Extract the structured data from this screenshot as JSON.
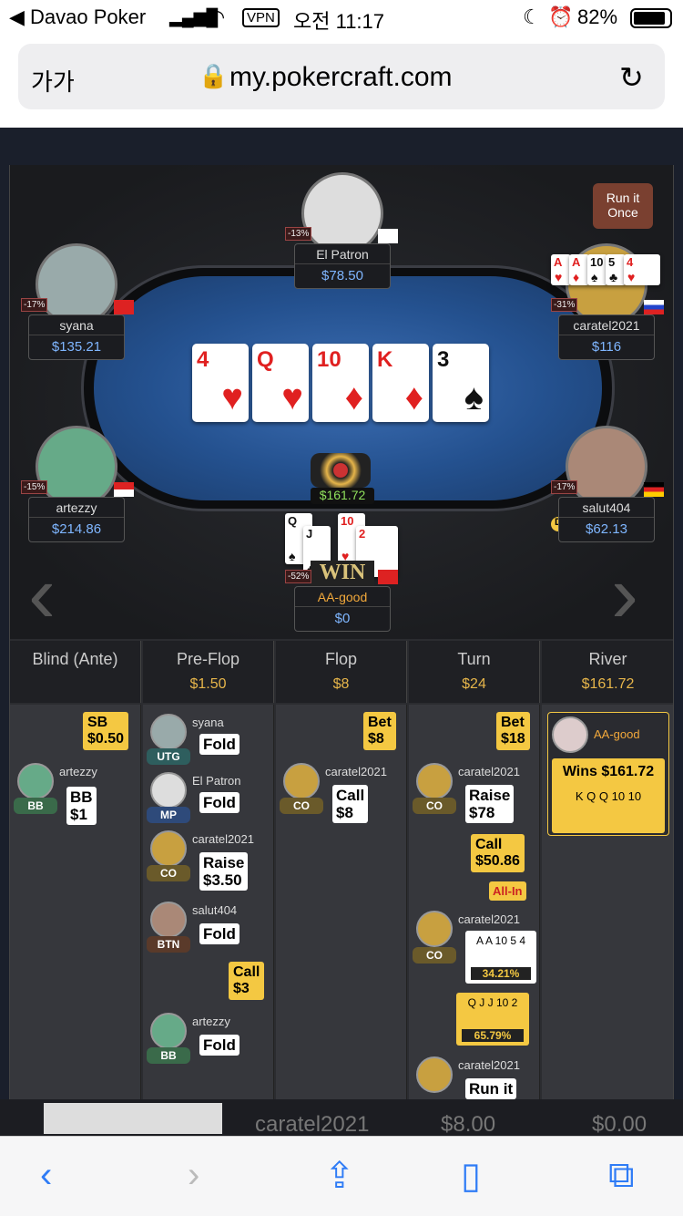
{
  "status_bar": {
    "carrier": "◀ Davao Poker",
    "vpn": "VPN",
    "time": "오전 11:17",
    "battery": "82%"
  },
  "browser": {
    "text_size": "가가",
    "url": "my.pokercraft.com"
  },
  "table": {
    "run_it_once": "Run it\nOnce",
    "pot": "$161.72",
    "win": "WIN",
    "board": [
      {
        "rank": "4",
        "suit": "♥",
        "color": "red"
      },
      {
        "rank": "Q",
        "suit": "♥",
        "color": "red"
      },
      {
        "rank": "10",
        "suit": "♦",
        "color": "red"
      },
      {
        "rank": "K",
        "suit": "♦",
        "color": "red"
      },
      {
        "rank": "3",
        "suit": "♠",
        "color": "blk"
      }
    ],
    "players": [
      {
        "name": "El Patron",
        "stack": "$78.50",
        "pct": "-13%"
      },
      {
        "name": "syana",
        "stack": "$135.21",
        "pct": "-17%"
      },
      {
        "name": "caratel2021",
        "stack": "$116",
        "pct": "-31%"
      },
      {
        "name": "artezzy",
        "stack": "$214.86",
        "pct": "-15%"
      },
      {
        "name": "salut404",
        "stack": "$62.13",
        "pct": "-17%"
      },
      {
        "name": "AA-good",
        "stack": "$0",
        "pct": "-52%"
      }
    ],
    "caratel_cards": [
      "A",
      "A",
      "10",
      "5",
      "4"
    ],
    "hero_cards": [
      "Q",
      "J",
      "10",
      "2"
    ]
  },
  "streets": [
    {
      "name": "Blind (Ante)",
      "pot": ""
    },
    {
      "name": "Pre-Flop",
      "pot": "$1.50"
    },
    {
      "name": "Flop",
      "pot": "$8"
    },
    {
      "name": "Turn",
      "pot": "$24"
    },
    {
      "name": "River",
      "pot": "$161.72"
    }
  ],
  "actions": {
    "sb": "SB\n$0.50",
    "bb": "BB\n$1",
    "pf_fold": "Fold",
    "pf_raise": "Raise\n$3.50",
    "pf_call": "Call\n$3",
    "flop_bet": "Bet\n$8",
    "flop_call": "Call\n$8",
    "turn_bet": "Bet\n$18",
    "turn_raise": "Raise\n$78",
    "turn_call": "Call\n$50.86",
    "allin": "All-In",
    "eq1": "34.21%",
    "eq2": "65.79%",
    "runit": "Run it",
    "wins": "Wins $161.72"
  },
  "positions": {
    "utg": "UTG",
    "mp": "MP",
    "co": "CO",
    "btn": "BTN",
    "bb": "BB"
  },
  "bottom_row": {
    "player": "caratel2021",
    "v1": "$8.00",
    "v2": "$0.00"
  }
}
